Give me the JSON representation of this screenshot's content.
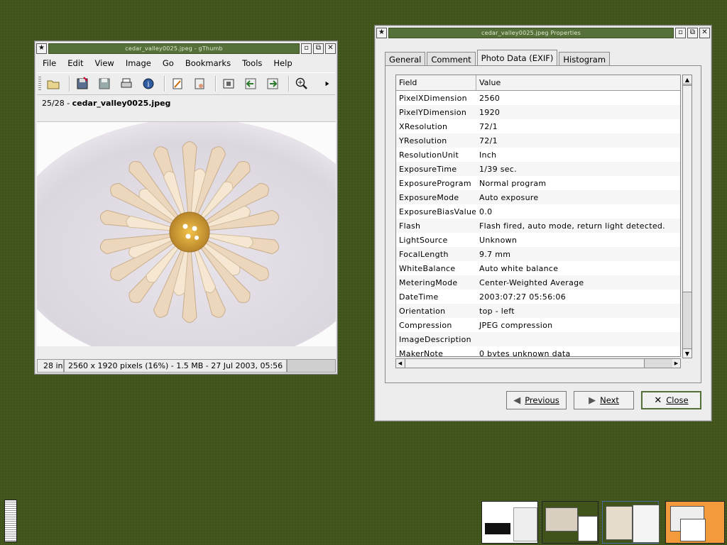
{
  "gthumb": {
    "title": "cedar_valley0025.jpeg - gThumb",
    "menu": [
      "File",
      "Edit",
      "View",
      "Image",
      "Go",
      "Bookmarks",
      "Tools",
      "Help"
    ],
    "position": "25/28 - ",
    "filename": "cedar_valley0025.jpeg",
    "status_left": "28 in",
    "status_info": "2560 x 1920 pixels (16%) - 1.5 MB - 27 Jul 2003, 05:56"
  },
  "props": {
    "title": "cedar_valley0025.jpeg Properties",
    "tabs": [
      "General",
      "Comment",
      "Photo Data (EXIF)",
      "Histogram"
    ],
    "col_field": "Field",
    "col_value": "Value",
    "rows": [
      {
        "field": "PixelXDimension",
        "value": "2560"
      },
      {
        "field": "PixelYDimension",
        "value": "1920"
      },
      {
        "field": "XResolution",
        "value": "72/1"
      },
      {
        "field": "YResolution",
        "value": "72/1"
      },
      {
        "field": "ResolutionUnit",
        "value": "Inch"
      },
      {
        "field": "ExposureTime",
        "value": "1/39 sec."
      },
      {
        "field": "ExposureProgram",
        "value": "Normal program"
      },
      {
        "field": "ExposureMode",
        "value": "Auto exposure"
      },
      {
        "field": "ExposureBiasValue",
        "value": "0.0"
      },
      {
        "field": "Flash",
        "value": "Flash fired, auto mode, return light detected."
      },
      {
        "field": "LightSource",
        "value": "Unknown"
      },
      {
        "field": "FocalLength",
        "value": "9.7 mm"
      },
      {
        "field": "WhiteBalance",
        "value": "Auto white balance"
      },
      {
        "field": "MeteringMode",
        "value": "Center-Weighted Average"
      },
      {
        "field": "DateTime",
        "value": "2003:07:27 05:56:06"
      },
      {
        "field": "Orientation",
        "value": "top - left"
      },
      {
        "field": "Compression",
        "value": "JPEG compression"
      },
      {
        "field": "ImageDescription",
        "value": ""
      },
      {
        "field": "MakerNote",
        "value": "0 bytes unknown data"
      }
    ],
    "btn_previous": "Previous",
    "btn_next": "Next",
    "btn_close": "Close"
  },
  "colors": {
    "desktop": "#3f531b",
    "titlebar": "#56703a",
    "pager_active": "#f39a3c"
  }
}
